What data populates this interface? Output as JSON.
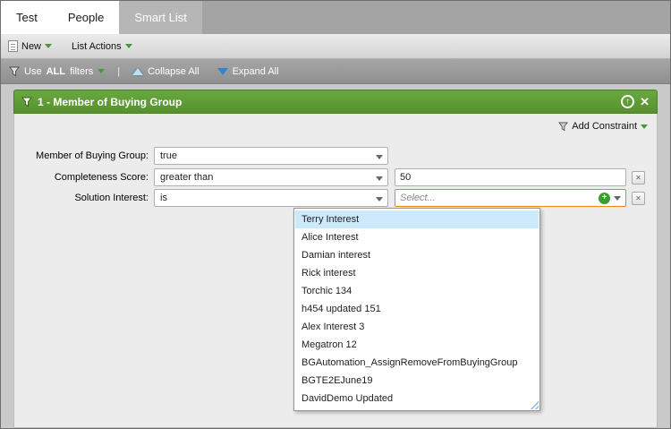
{
  "tabs": {
    "items": [
      {
        "label": "Test",
        "active": false
      },
      {
        "label": "People",
        "active": false
      },
      {
        "label": "Smart List",
        "active": true
      }
    ]
  },
  "toolbar": {
    "new_label": "New",
    "list_actions_label": "List Actions"
  },
  "filter_toolbar": {
    "use_prefix": "Use",
    "use_bold": "ALL",
    "use_suffix": "filters",
    "divider": "|",
    "collapse_all": "Collapse All",
    "expand_all": "Expand All"
  },
  "panel": {
    "title": "1 - Member of Buying Group",
    "add_constraint": "Add Constraint",
    "promote_icon": "up-arrow-circle",
    "close_icon": "x",
    "rows": [
      {
        "label": "Member of Buying Group:",
        "operator": "true"
      },
      {
        "label": "Completeness Score:",
        "operator": "greater than",
        "value": "50"
      },
      {
        "label": "Solution Interest:",
        "operator": "is",
        "placeholder": "Select..."
      }
    ],
    "dropdown_items": [
      "Terry Interest",
      "Alice Interest",
      "Damian interest",
      "Rick interest",
      "Torchic 134",
      "h454 updated 151",
      "Alex Interest 3",
      "Megatron 12",
      "BGAutomation_AssignRemoveFromBuyingGroup",
      "BGTE2EJune19",
      "DavidDemo Updated"
    ],
    "highlighted_item_index": 0
  },
  "icons": {
    "filter": "funnel-icon",
    "promote": "up-arrow-circle-icon",
    "close": "close-icon",
    "add": "green-plus-icon",
    "remove": "remove-x-icon"
  },
  "colors": {
    "green_header": "#5f9e33",
    "accent_green": "#3f9c35",
    "focus_orange": "#e8890c",
    "highlight_blue": "#cde9fc",
    "toolbar_gray": "#9a9a9a"
  },
  "glyphs": {
    "up_arrow": "↑",
    "close_x": "✕",
    "remove_x": "✕",
    "plus": "+"
  }
}
